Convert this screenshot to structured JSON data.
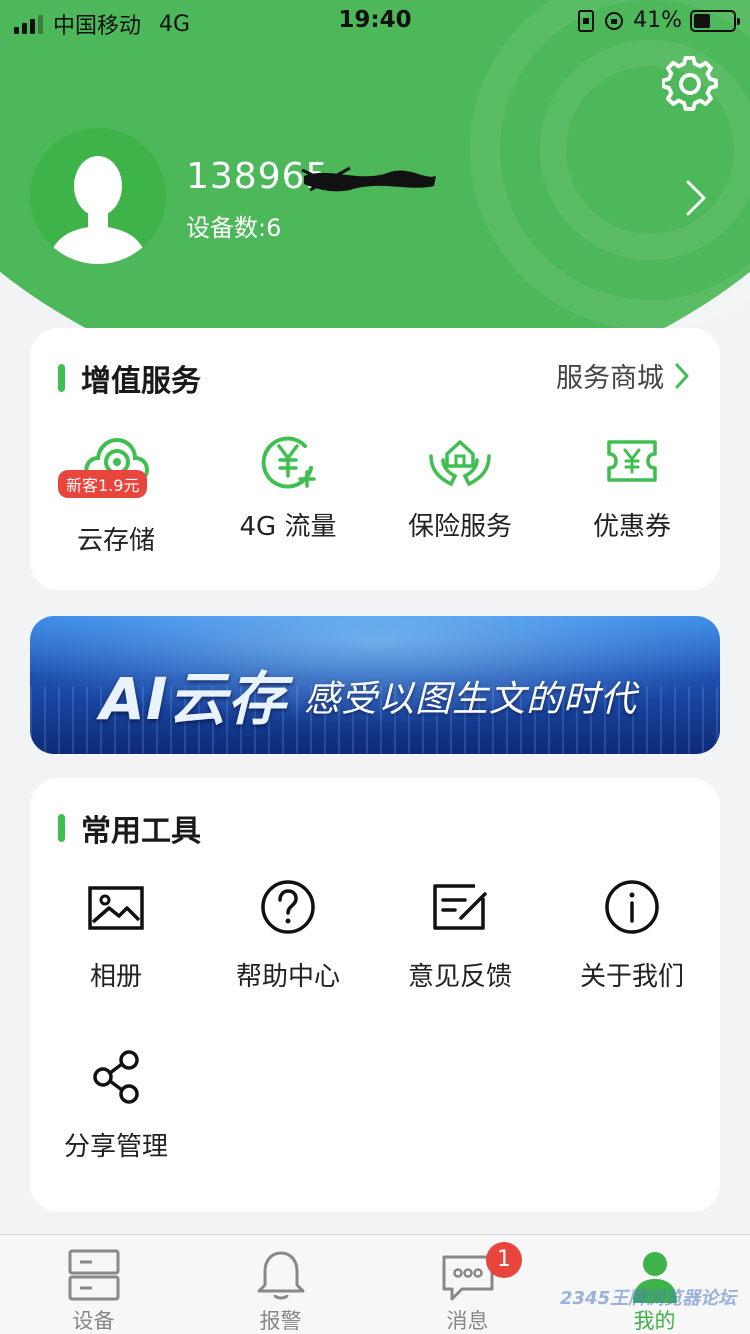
{
  "status_bar": {
    "carrier": "中国移动",
    "network": "4G",
    "time": "19:40",
    "battery": "41%",
    "battery_level": 0.41
  },
  "profile": {
    "phone_visible": "138965",
    "device_count": "设备数:6"
  },
  "value_services": {
    "title": "增值服务",
    "more": "服务商城",
    "items": [
      {
        "label": "云存储",
        "icon": "cloud-camera-icon",
        "badge": "新客1.9元"
      },
      {
        "label": "4G 流量",
        "icon": "yuan-data-icon"
      },
      {
        "label": "保险服务",
        "icon": "home-hands-icon"
      },
      {
        "label": "优惠券",
        "icon": "coupon-icon"
      }
    ]
  },
  "banner": {
    "ai_text": "AI云存",
    "sub_text": "感受以图生文的时代"
  },
  "tools": {
    "title": "常用工具",
    "items": [
      {
        "label": "相册",
        "icon": "image-icon"
      },
      {
        "label": "帮助中心",
        "icon": "help-icon"
      },
      {
        "label": "意见反馈",
        "icon": "feedback-icon"
      },
      {
        "label": "关于我们",
        "icon": "info-icon"
      },
      {
        "label": "分享管理",
        "icon": "share-icon"
      }
    ]
  },
  "tabbar": {
    "items": [
      {
        "label": "设备",
        "icon": "device-icon"
      },
      {
        "label": "报警",
        "icon": "bell-icon"
      },
      {
        "label": "消息",
        "icon": "message-icon",
        "badge": "1"
      },
      {
        "label": "我的",
        "icon": "user-icon",
        "active": true
      }
    ]
  },
  "watermark": "2345王牌浏览器论坛",
  "colors": {
    "brand_green": "#4cb85a",
    "accent_green": "#3fbf4f",
    "badge_red": "#e8453c"
  }
}
